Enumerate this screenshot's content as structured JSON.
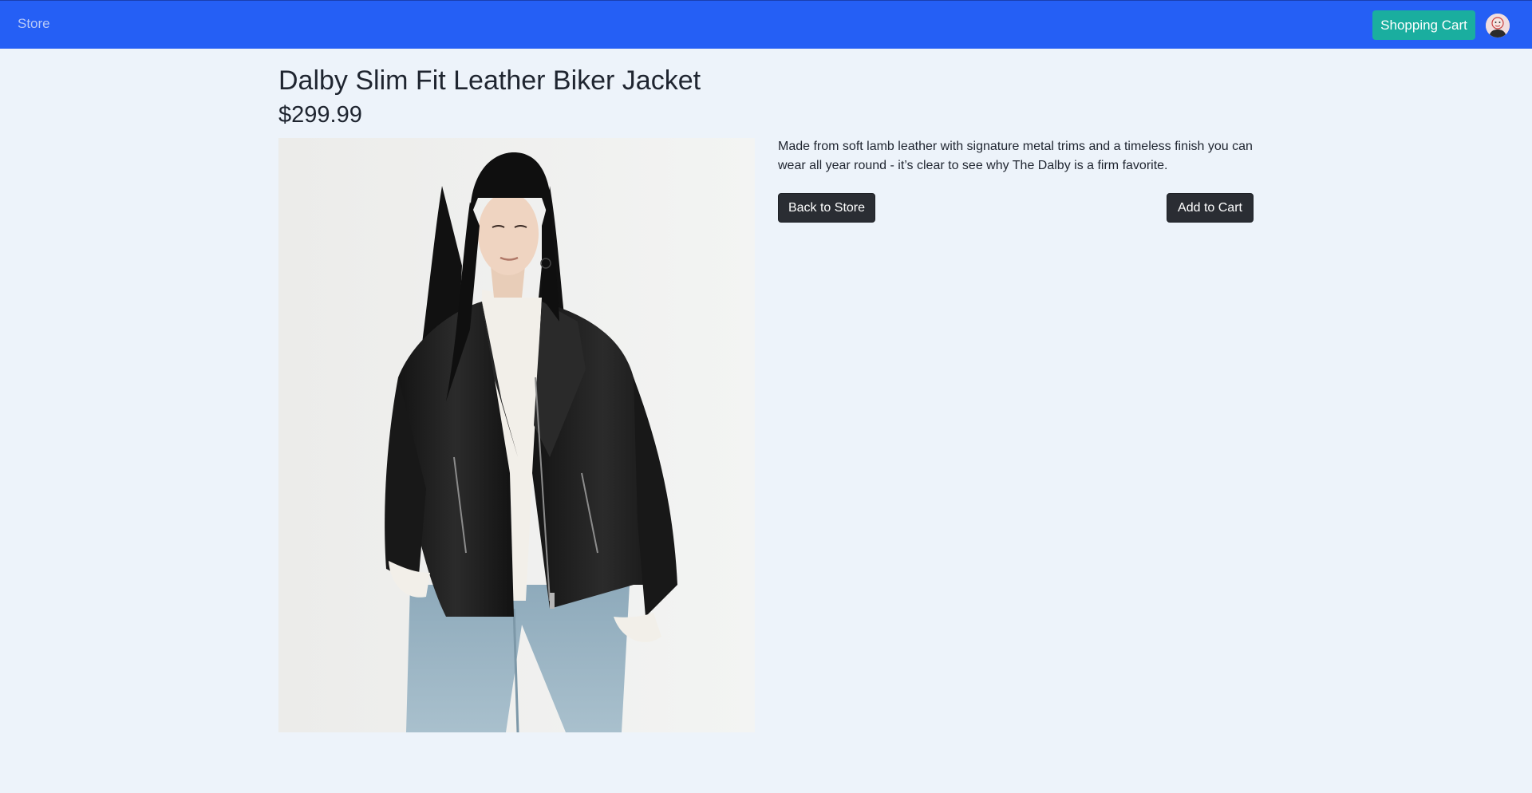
{
  "navbar": {
    "brand": "Store",
    "cart_label": "Shopping Cart",
    "brand_color": "#255ff5",
    "cart_color": "#1aae9f"
  },
  "product": {
    "title": "Dalby Slim Fit Leather Biker Jacket",
    "price": "$299.99",
    "description": "Made from soft lamb leather with signature metal trims and a timeless finish you can wear all year round - it’s clear to see why The Dalby is a firm favorite.",
    "image_alt": "Dalby Slim Fit Leather Biker Jacket"
  },
  "actions": {
    "back_label": "Back to Store",
    "add_label": "Add to Cart"
  },
  "icons": {
    "avatar": "user-avatar-icon"
  }
}
